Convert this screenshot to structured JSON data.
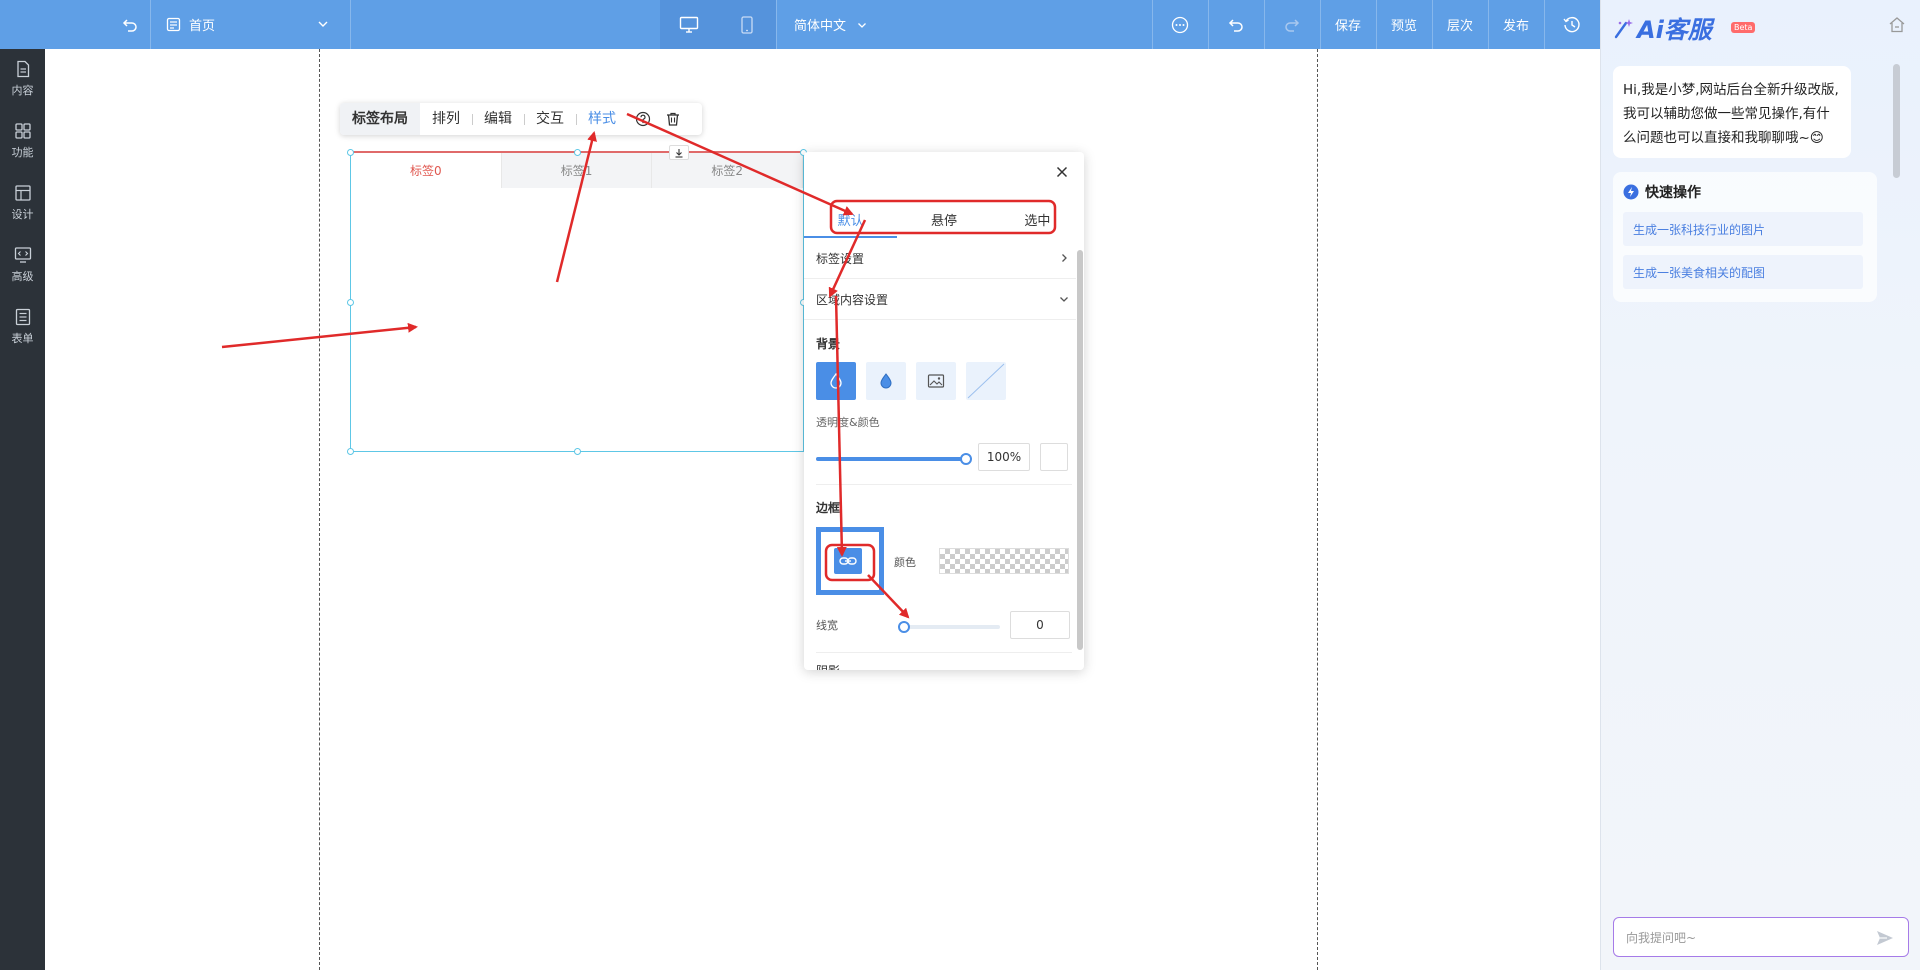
{
  "topbar": {
    "page_name": "首页",
    "language": "简体中文",
    "actions": [
      "保存",
      "预览",
      "层次",
      "发布"
    ],
    "icons": [
      "undo-icon",
      "page-icon",
      "chevron-down-icon",
      "desktop-icon",
      "mobile-icon",
      "more-icon",
      "redo-icon",
      "history-icon"
    ]
  },
  "sidebar": {
    "items": [
      {
        "label": "内容",
        "icon": "document-icon"
      },
      {
        "label": "功能",
        "icon": "grid-icon"
      },
      {
        "label": "设计",
        "icon": "layout-icon"
      },
      {
        "label": "高级",
        "icon": "code-icon"
      },
      {
        "label": "表单",
        "icon": "form-icon"
      }
    ]
  },
  "float_toolbar": {
    "title": "标签布局",
    "buttons": [
      "排列",
      "编辑",
      "交互",
      "样式"
    ],
    "active": "样式"
  },
  "widget": {
    "tabs": [
      "标签0",
      "标签1",
      "标签2"
    ],
    "active_tab": 0
  },
  "style_panel": {
    "states": [
      "默认",
      "悬停",
      "选中"
    ],
    "active_state": "默认",
    "sections": [
      "标签设置",
      "区域内容设置"
    ],
    "background": {
      "heading": "背景",
      "opacity_label": "透明度&颜色",
      "opacity_value": "100%",
      "opacity_fraction": 1.0
    },
    "border": {
      "heading": "边框",
      "color_label": "颜色",
      "width_label": "线宽",
      "width_value": "0",
      "width_fraction": 0.0
    },
    "shadow_heading": "阴影"
  },
  "ai_panel": {
    "logo": "Ai客服",
    "badge": "Beta",
    "greeting": "Hi,我是小梦,网站后台全新升级改版,我可以辅助您做一些常见操作,有什么问题也可以直接和我聊聊哦~😊",
    "quick_title": "快速操作",
    "quick_actions": [
      "生成一张科技行业的图片",
      "生成一张美食相关的配图"
    ],
    "input_placeholder": "向我提问吧~"
  },
  "colors": {
    "topbar": "#5f9fe6",
    "sidebar": "#2c3239",
    "accent": "#4a8ee6",
    "annotation": "#e02a2a",
    "active_tab_text": "#e0574f"
  }
}
